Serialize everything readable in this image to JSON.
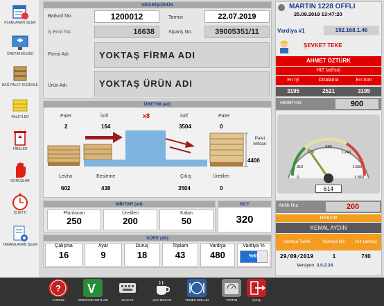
{
  "sidebar": {
    "items": [
      {
        "label": "PLANLANAN İŞLER"
      },
      {
        "label": "ÜRETİM BİLGİSİ"
      },
      {
        "label": "BAĞ PALET DÜZENLE"
      },
      {
        "label": "PALETLER"
      },
      {
        "label": "FİRELER"
      },
      {
        "label": "DURUŞLAR"
      },
      {
        "label": "İŞ BİTTİ"
      },
      {
        "label": "TAMAMLANAN İŞLER"
      }
    ]
  },
  "order": {
    "title": "SİPARİŞ/ÜRÜN",
    "barcode_label": "Barkod No.",
    "barcode": "1200012",
    "deadline_label": "Termin",
    "deadline": "22.07.2019",
    "work_order_label": "İş Emri No.",
    "work_order": "16638",
    "order_no_label": "Sipariş No.",
    "order_no": "39005351/11",
    "company_label": "Firma Adı",
    "company": "YOKTAŞ FİRMA ADI",
    "product_label": "Ürün Adı",
    "product": "YOKTAŞ ÜRÜN ADI"
  },
  "production": {
    "title": "ÜRETİM (ad)",
    "palet1_label": "Palet",
    "palet1": "2",
    "istif1_label": "İstif",
    "istif1": "164",
    "multiplier": "x8",
    "istif2_label": "İstif",
    "istif2": "3504",
    "palet2_label": "Palet",
    "palet2": "0",
    "palet_miktari_label": "Palet Miktarı",
    "palet_miktari": "4400",
    "levha_label": "Levha",
    "levha": "602",
    "besleme_label": "Besleme",
    "besleme": "438",
    "cikis_label": "Çıkış",
    "cikis": "3504",
    "uretilen_label": "Üretilen",
    "uretilen": "0"
  },
  "quantity": {
    "title": "MİKTAR (ad)",
    "planned_label": "Planlanan",
    "planned": "250",
    "produced_label": "Üretilen",
    "produced": "200",
    "remaining_label": "Kalan",
    "remaining": "50"
  },
  "bct": {
    "label": "BCT",
    "value": "320"
  },
  "duration": {
    "title": "SÜRE (dk)",
    "work_label": "Çalışma",
    "work": "16",
    "setup_label": "Ayar",
    "setup": "9",
    "stop_label": "Duruş",
    "stop": "18",
    "total_label": "Toplam",
    "total": "43",
    "shift_label": "Vardiya",
    "shift": "480",
    "shift_pct_label": "Vardiya %",
    "shift_pct": "%63",
    "shift_pct_value": 0.63
  },
  "machine": {
    "name": "MARTIN 1228 OFFLI",
    "datetime": "25.09.2019 13:47:20",
    "shift_label": "Vardiya #1",
    "ip": "192.168.1.46",
    "operator": "ŞEVKET TEKE",
    "operator2": "AHMET ÖZTÜRK",
    "speed_title": "HIZ (ad/sa)",
    "best_label": "En İyi",
    "avg_label": "Ortalama",
    "last_label": "En Son",
    "best": "3195",
    "avg": "2521",
    "last": "3195",
    "target_label": "Hedef Hız",
    "target": "900"
  },
  "gauge": {
    "ticks": [
      "620",
      "930",
      "1.240",
      "310",
      "1.550",
      "1.860",
      "0"
    ],
    "value": "614",
    "value_num": 614,
    "max": 2000
  },
  "instant_speed": {
    "label": "Anlık Hız",
    "value": "200"
  },
  "record": {
    "title": "REKOR",
    "name": "KEMAL AYDIN",
    "date_label": "Vardiya Tarihi",
    "shiftno_label": "Vardiya No.",
    "speed_label": "Hız (ad/sa)",
    "date": "29/09/2019",
    "shiftno": "1",
    "speed": "740"
  },
  "version": {
    "label": "Versiyon",
    "value": "3.0.2.24"
  },
  "bottombar": {
    "items": [
      {
        "label": "YARDIM"
      },
      {
        "label": "VERSİYON NOTLARI"
      },
      {
        "label": "KLAVYE"
      },
      {
        "label": "ÇAY MOLASI"
      },
      {
        "label": "YEMEK MOLASI"
      },
      {
        "label": "TARTIM"
      },
      {
        "label": "ÇIKIŞ"
      }
    ]
  },
  "colors": {
    "accent_red": "#e00000",
    "header_blue": "#1a3a8a",
    "orange": "#f39c1f",
    "progress_blue": "#1f6fd8"
  }
}
